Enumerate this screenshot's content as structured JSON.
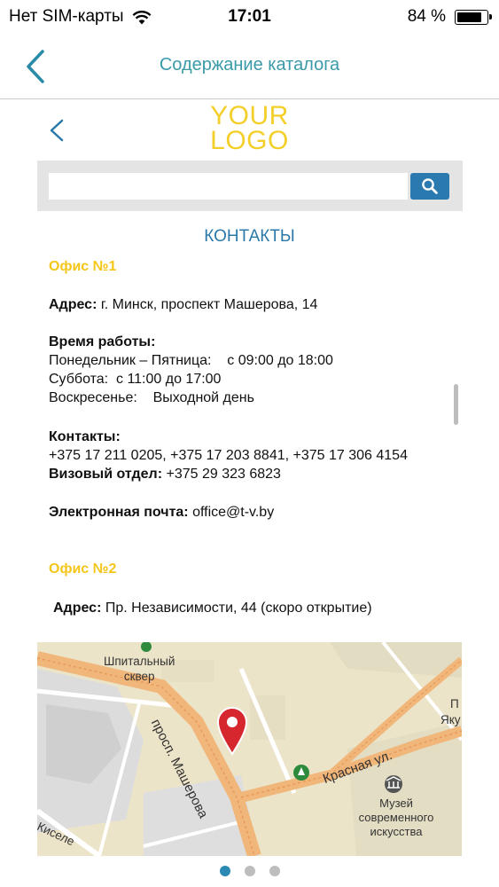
{
  "status_bar": {
    "carrier": "Нет SIM-карты",
    "time": "17:01",
    "battery": "84 %",
    "battery_level": 0.84
  },
  "nav": {
    "title": "Содержание каталога"
  },
  "header": {
    "logo_line1": "YOUR",
    "logo_line2": "LOGO"
  },
  "search": {
    "value": "",
    "placeholder": ""
  },
  "content": {
    "section_title": "КОНТАКТЫ",
    "office1": {
      "title": "Офис №1",
      "address_label": "Адрес:",
      "address_value": " г. Минск, проспект Машерова, 14",
      "hours_label": "Время работы:",
      "hours_line1": "Понедельник – Пятница:    с 09:00 до 18:00",
      "hours_line2": "Суббота:  с 11:00 до 17:00",
      "hours_line3": "Воскресенье:    Выходной день",
      "contacts_label": "Контакты:",
      "contacts_value": "+375 17 211 0205, +375 17 203 8841, +375 17 306 4154",
      "visa_label": "Визовый отдел:",
      "visa_value": " +375 29 323 6823",
      "email_label": "Электронная почта:",
      "email_value": " office@t-v.by"
    },
    "office2": {
      "title": "Офис №2",
      "address_label": "Адрес:",
      "address_value": " Пр. Независимости, 44 (скоро открытие)"
    }
  },
  "map": {
    "labels": {
      "park_line1": "Шпитальный",
      "park_line2": "сквер",
      "street1": "просп. Машерова",
      "street2": "Красная ул.",
      "museum_line1": "Музей",
      "museum_line2": "современного",
      "museum_line3": "искусства",
      "edge1": "П",
      "edge2": "Яку",
      "edge3": "Киселе"
    }
  },
  "pager": {
    "count": 3,
    "active_index": 0
  }
}
